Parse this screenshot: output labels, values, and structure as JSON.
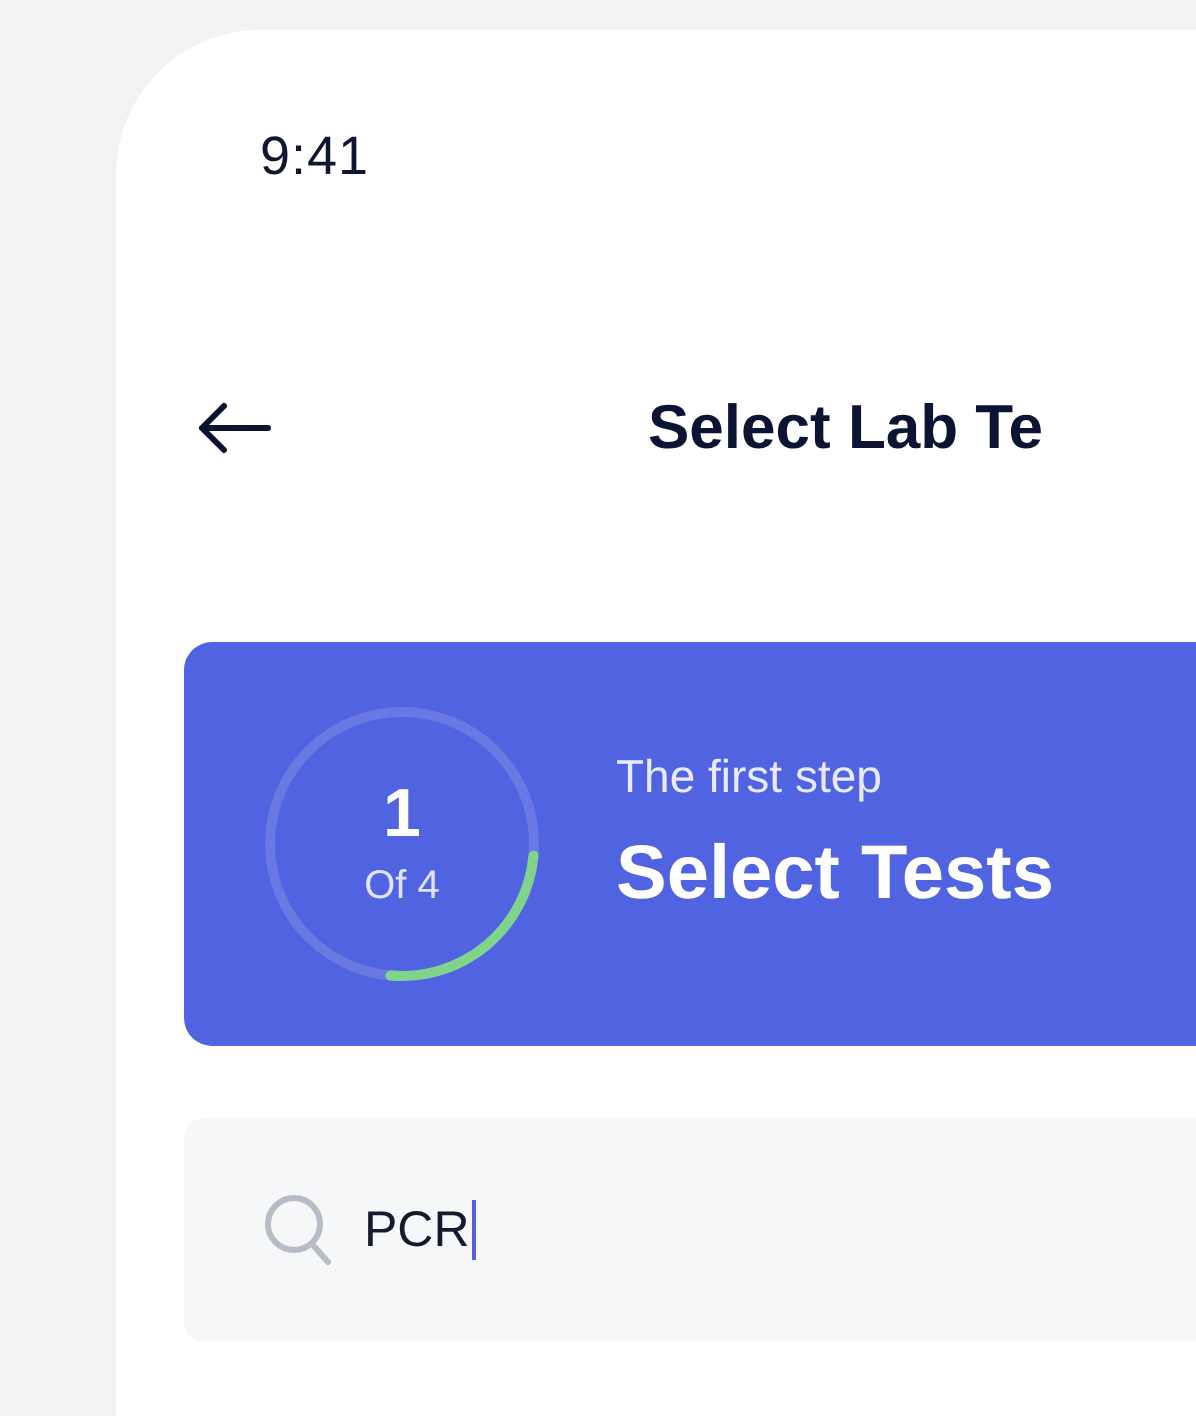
{
  "status_bar": {
    "time": "9:41"
  },
  "header": {
    "title": "Select Lab Te"
  },
  "step_banner": {
    "step": "1",
    "of": "Of 4",
    "level": 0.25,
    "caption": "The first step",
    "title": "Select Tests"
  },
  "search": {
    "value": "PCR",
    "focused": true
  }
}
